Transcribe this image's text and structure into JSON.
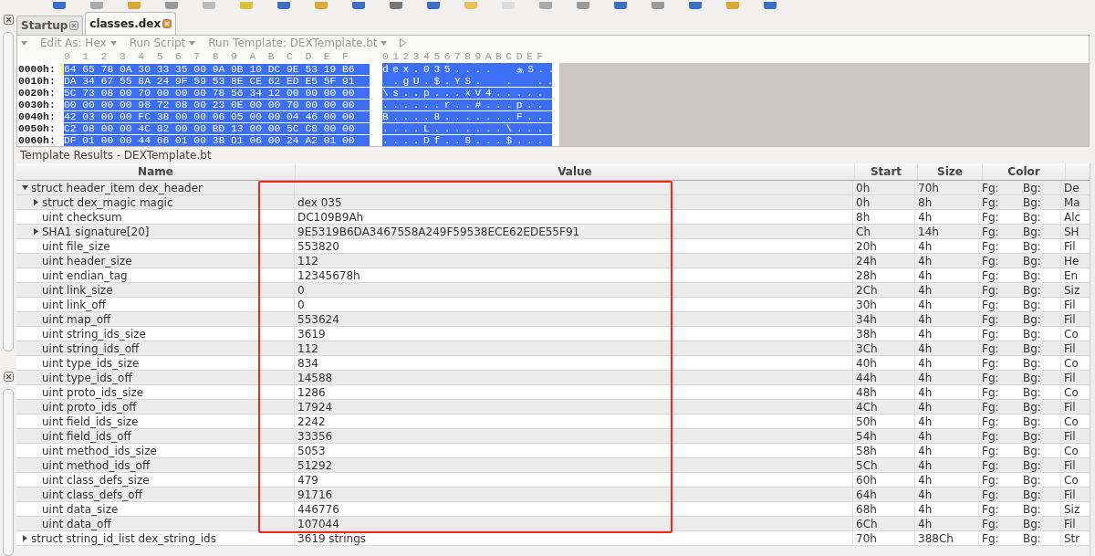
{
  "tabs": [
    {
      "label": "Startup",
      "selected": false
    },
    {
      "label": "classes.dex",
      "selected": true
    }
  ],
  "editor_toolbar": {
    "items": [
      "Edit As: Hex",
      "Run Script",
      "Run Template: DEXTemplate.bt"
    ]
  },
  "hex": {
    "hex_header": "0  1  2  3  4  5  6  7  8  9  A  B  C  D  E  F",
    "ascii_header": "0123456789ABCDEF",
    "rows": [
      {
        "offset": "0000h:",
        "bytes": "64 65 78 0A 30 33 35 00 9A 9B 10 DC 9E 53 19 B6",
        "ascii": "dex.035....  ௲S..",
        "selected": true
      },
      {
        "offset": "0010h:",
        "bytes": "DA 34 67 55 8A 24 9F 59 53 8E CE 62 ED E5 5F 91",
        "ascii": " .gU.$.YS.  .  ..",
        "selected": true
      },
      {
        "offset": "0020h:",
        "bytes": "5C 73 08 00 70 00 00 00 78 56 34 12 00 00 00 00",
        "ascii": "\\s..p...xV4.....",
        "selected": true
      },
      {
        "offset": "0030h:",
        "bytes": "00 00 00 00 98 72 08 00 23 0E 00 00 70 00 00 00",
        "ascii": "......r..#...p..",
        "selected": true
      },
      {
        "offset": "0040h:",
        "bytes": "42 03 00 00 FC 38 00 00 06 05 00 00 04 46 00 00",
        "ascii": "B....8.......F..",
        "selected": true
      },
      {
        "offset": "0050h:",
        "bytes": "C2 08 00 00 4C 82 00 00 BD 13 00 00 5C C8 00 00",
        "ascii": "....L.......\\...",
        "selected": true
      },
      {
        "offset": "0060h:",
        "bytes": "DF 01 00 00 44 66 01 00 38 D1 06 00 24 A2 01 00",
        "ascii": "....Df..8...$...",
        "selected": true
      }
    ]
  },
  "template_results": {
    "title": "Template Results - DEXTemplate.bt",
    "columns": [
      "Name",
      "Value",
      "Start",
      "Size",
      "Color"
    ],
    "rows": [
      {
        "name": "struct header_item dex_header",
        "value": "",
        "start": "0h",
        "size": "70h",
        "fg": "Fg:",
        "bg": "Bg:",
        "comment": "De",
        "expanded": true,
        "children": [
          {
            "name": "struct dex_magic magic",
            "value": "dex 035",
            "start": "0h",
            "size": "8h",
            "fg": "Fg:",
            "bg": "Bg:",
            "comment": "Ma",
            "expanded": false
          },
          {
            "name": "uint checksum",
            "value": "DC109B9Ah",
            "start": "8h",
            "size": "4h",
            "fg": "Fg:",
            "bg": "Bg:",
            "comment": "Alc"
          },
          {
            "name": "SHA1 signature[20]",
            "value": "9E5319B6DA3467558A249F59538ECE62EDE55F91",
            "start": "Ch",
            "size": "14h",
            "fg": "Fg:",
            "bg": "Bg:",
            "comment": "SH",
            "expanded": false
          },
          {
            "name": "uint file_size",
            "value": "553820",
            "start": "20h",
            "size": "4h",
            "fg": "Fg:",
            "bg": "Bg:",
            "comment": "Fil"
          },
          {
            "name": "uint header_size",
            "value": "112",
            "start": "24h",
            "size": "4h",
            "fg": "Fg:",
            "bg": "Bg:",
            "comment": "He"
          },
          {
            "name": "uint endian_tag",
            "value": "12345678h",
            "start": "28h",
            "size": "4h",
            "fg": "Fg:",
            "bg": "Bg:",
            "comment": "En"
          },
          {
            "name": "uint link_size",
            "value": "0",
            "start": "2Ch",
            "size": "4h",
            "fg": "Fg:",
            "bg": "Bg:",
            "comment": "Siz"
          },
          {
            "name": "uint link_off",
            "value": "0",
            "start": "30h",
            "size": "4h",
            "fg": "Fg:",
            "bg": "Bg:",
            "comment": "Fil"
          },
          {
            "name": "uint map_off",
            "value": "553624",
            "start": "34h",
            "size": "4h",
            "fg": "Fg:",
            "bg": "Bg:",
            "comment": "Fil"
          },
          {
            "name": "uint string_ids_size",
            "value": "3619",
            "start": "38h",
            "size": "4h",
            "fg": "Fg:",
            "bg": "Bg:",
            "comment": "Co"
          },
          {
            "name": "uint string_ids_off",
            "value": "112",
            "start": "3Ch",
            "size": "4h",
            "fg": "Fg:",
            "bg": "Bg:",
            "comment": "Fil"
          },
          {
            "name": "uint type_ids_size",
            "value": "834",
            "start": "40h",
            "size": "4h",
            "fg": "Fg:",
            "bg": "Bg:",
            "comment": "Co"
          },
          {
            "name": "uint type_ids_off",
            "value": "14588",
            "start": "44h",
            "size": "4h",
            "fg": "Fg:",
            "bg": "Bg:",
            "comment": "Fil"
          },
          {
            "name": "uint proto_ids_size",
            "value": "1286",
            "start": "48h",
            "size": "4h",
            "fg": "Fg:",
            "bg": "Bg:",
            "comment": "Co"
          },
          {
            "name": "uint proto_ids_off",
            "value": "17924",
            "start": "4Ch",
            "size": "4h",
            "fg": "Fg:",
            "bg": "Bg:",
            "comment": "Fil"
          },
          {
            "name": "uint field_ids_size",
            "value": "2242",
            "start": "50h",
            "size": "4h",
            "fg": "Fg:",
            "bg": "Bg:",
            "comment": "Co"
          },
          {
            "name": "uint field_ids_off",
            "value": "33356",
            "start": "54h",
            "size": "4h",
            "fg": "Fg:",
            "bg": "Bg:",
            "comment": "Fil"
          },
          {
            "name": "uint method_ids_size",
            "value": "5053",
            "start": "58h",
            "size": "4h",
            "fg": "Fg:",
            "bg": "Bg:",
            "comment": "Co"
          },
          {
            "name": "uint method_ids_off",
            "value": "51292",
            "start": "5Ch",
            "size": "4h",
            "fg": "Fg:",
            "bg": "Bg:",
            "comment": "Fil"
          },
          {
            "name": "uint class_defs_size",
            "value": "479",
            "start": "60h",
            "size": "4h",
            "fg": "Fg:",
            "bg": "Bg:",
            "comment": "Co"
          },
          {
            "name": "uint class_defs_off",
            "value": "91716",
            "start": "64h",
            "size": "4h",
            "fg": "Fg:",
            "bg": "Bg:",
            "comment": "Fil"
          },
          {
            "name": "uint data_size",
            "value": "446776",
            "start": "68h",
            "size": "4h",
            "fg": "Fg:",
            "bg": "Bg:",
            "comment": "Siz"
          },
          {
            "name": "uint data_off",
            "value": "107044",
            "start": "6Ch",
            "size": "4h",
            "fg": "Fg:",
            "bg": "Bg:",
            "comment": "Fil"
          }
        ]
      },
      {
        "name": "struct string_id_list dex_string_ids",
        "value": "3619 strings",
        "start": "70h",
        "size": "388Ch",
        "fg": "Fg:",
        "bg": "Bg:",
        "comment": "Str",
        "expanded": false
      }
    ]
  }
}
